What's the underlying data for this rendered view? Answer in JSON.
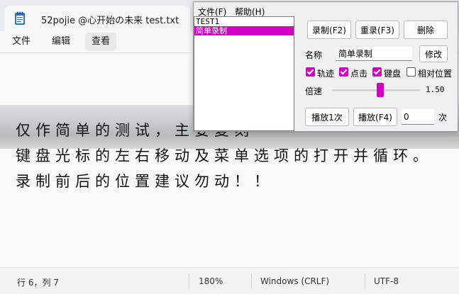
{
  "notepad": {
    "tab_title": "52pojie @心开始の未来 test.txt",
    "menu": [
      "文件",
      "编辑",
      "查看"
    ],
    "active_menu": 2,
    "content_lines": [
      "仅作简单的测试，主要复刻",
      "键盘光标的左右移动及菜单选项的打开并循环。",
      "录制前后的位置建议勿动！！"
    ],
    "status": {
      "position": "行 6，列 7",
      "zoom": "180%",
      "line_ending": "Windows (CRLF)",
      "encoding": "UTF-8"
    }
  },
  "recorder": {
    "menu": [
      "文件(F)",
      "帮助(H)"
    ],
    "list": [
      {
        "label": "TEST1",
        "selected": false
      },
      {
        "label": "简单录制",
        "selected": true
      }
    ],
    "buttons": {
      "record": "录制(F2)",
      "rerecord": "重录(F3)",
      "delete": "删除",
      "modify": "修改",
      "play_once": "播放1次",
      "play": "播放(F4)"
    },
    "name_label": "名称",
    "name_value": "简单录制",
    "options": [
      {
        "label": "轨迹",
        "checked": true
      },
      {
        "label": "点击",
        "checked": true
      },
      {
        "label": "键盘",
        "checked": true
      },
      {
        "label": "相对位置",
        "checked": false
      }
    ],
    "speed_label": "倍速",
    "speed_value": "1.50",
    "speed_slider_fraction": 0.55,
    "count_value": "0",
    "count_suffix": "次"
  },
  "colors": {
    "accent": "#d400c4"
  }
}
